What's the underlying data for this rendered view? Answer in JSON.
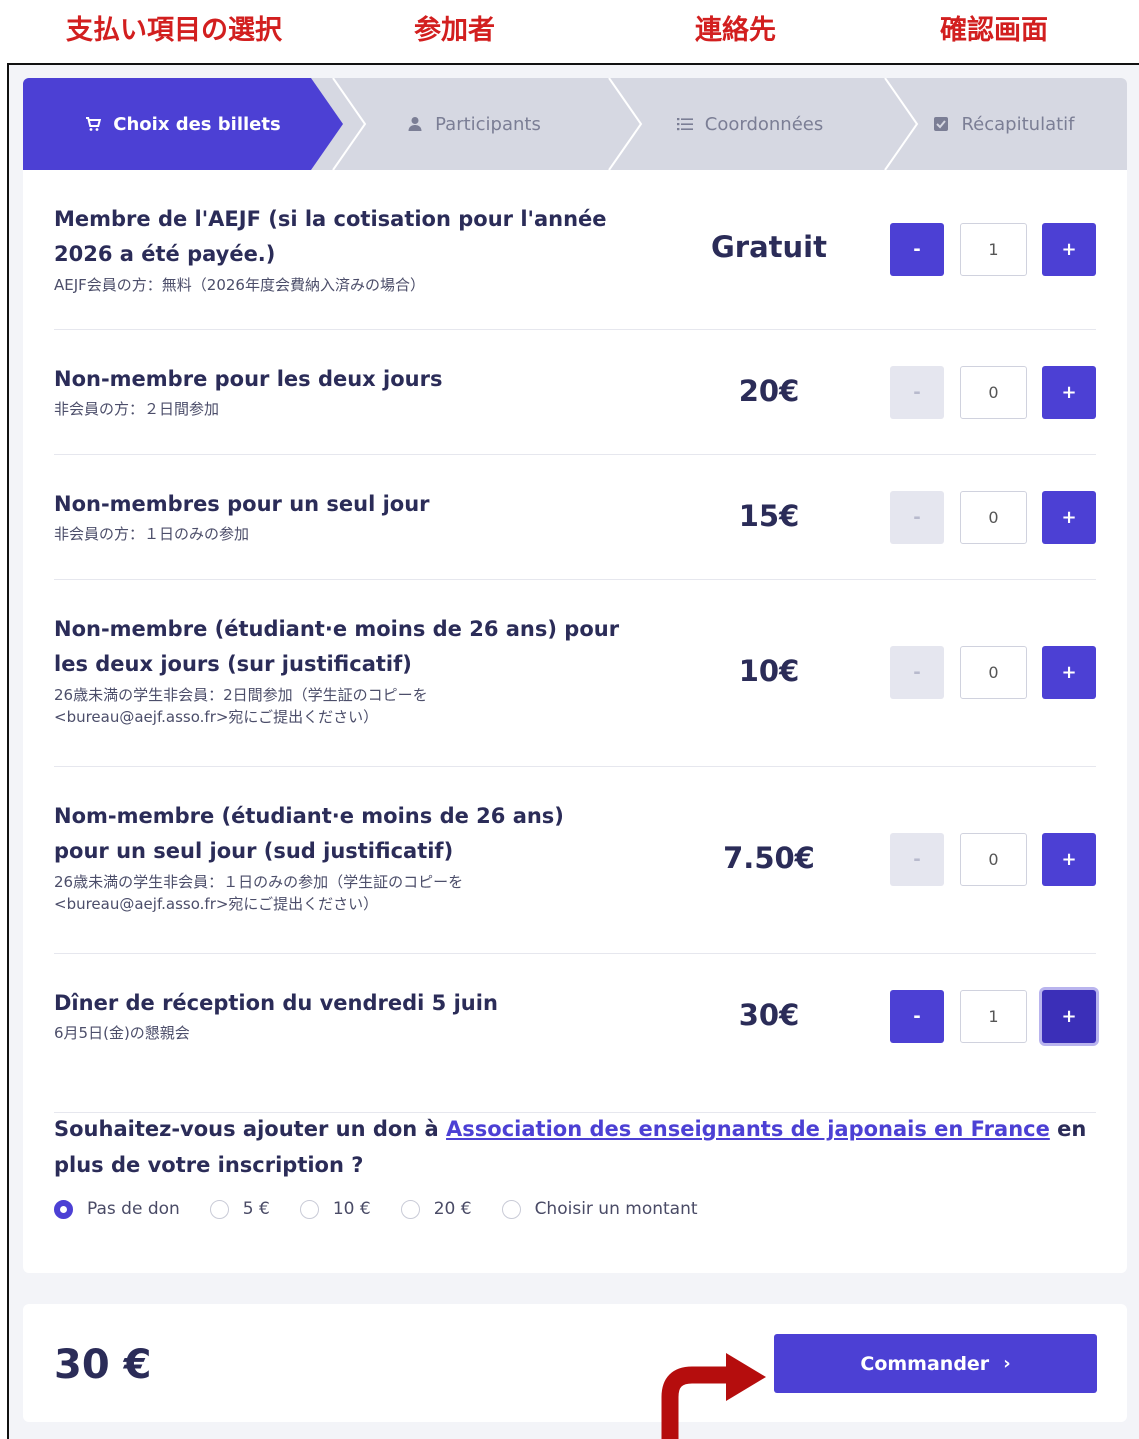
{
  "annotations": {
    "steps_jp": [
      "支払い項目の選択",
      "参加者",
      "連絡先",
      "確認画面"
    ]
  },
  "stepper": {
    "steps": [
      {
        "label": "Choix des billets",
        "icon": "cart-icon",
        "active": true
      },
      {
        "label": "Participants",
        "icon": "user-icon",
        "active": false
      },
      {
        "label": "Coordonnées",
        "icon": "list-icon",
        "active": false
      },
      {
        "label": "Récapitulatif",
        "icon": "checkbox-icon",
        "active": false
      }
    ]
  },
  "tickets": [
    {
      "title": "Membre de l'AEJF (si la cotisation pour l'année 2026 a été payée.)",
      "subtitle": "AEJF会員の方：無料（2026年度会費納入済みの場合）",
      "price": "Gratuit",
      "quantity": "1"
    },
    {
      "title": "Non-membre pour les deux jours",
      "subtitle": "非会員の方：２日間参加",
      "price": "20€",
      "quantity": "0"
    },
    {
      "title": "Non-membres pour un seul jour",
      "subtitle": "非会員の方：１日のみの参加",
      "price": "15€",
      "quantity": "0"
    },
    {
      "title": "Non-membre (étudiant·e moins de 26 ans) pour les deux jours (sur justificatif)",
      "subtitle": "26歳未満の学生非会員：2日間参加（学生証のコピーを <bureau@aejf.asso.fr>宛にご提出ください）",
      "price": "10€",
      "quantity": "0"
    },
    {
      "title": "Nom-membre (étudiant·e moins de 26 ans) pour un seul jour (sud justificatif)",
      "subtitle": "26歳未満の学生非会員：１日のみの参加（学生証のコピーを <bureau@aejf.asso.fr>宛にご提出ください）",
      "price": "7.50€",
      "quantity": "0"
    },
    {
      "title": "Dîner de réception du vendredi 5 juin",
      "subtitle": "6月5日(金)の懇親会",
      "price": "30€",
      "quantity": "1"
    }
  ],
  "qty_controls": {
    "minus": "-",
    "plus": "+"
  },
  "donation": {
    "question_before": "Souhaitez-vous ajouter un don à ",
    "link": "Association des enseignants de japonais en France",
    "question_after": " en plus de votre inscription ?",
    "options": [
      "Pas de don",
      "5 €",
      "10 €",
      "20 €",
      "Choisir un montant"
    ],
    "selected": "Pas de don"
  },
  "footer": {
    "total": "30 €",
    "order_label": "Commander",
    "order_chevron": "›"
  },
  "colors": {
    "accent": "#4c40d4",
    "annotation_red": "#d21f1f",
    "arrow_red": "#b50d0d"
  }
}
